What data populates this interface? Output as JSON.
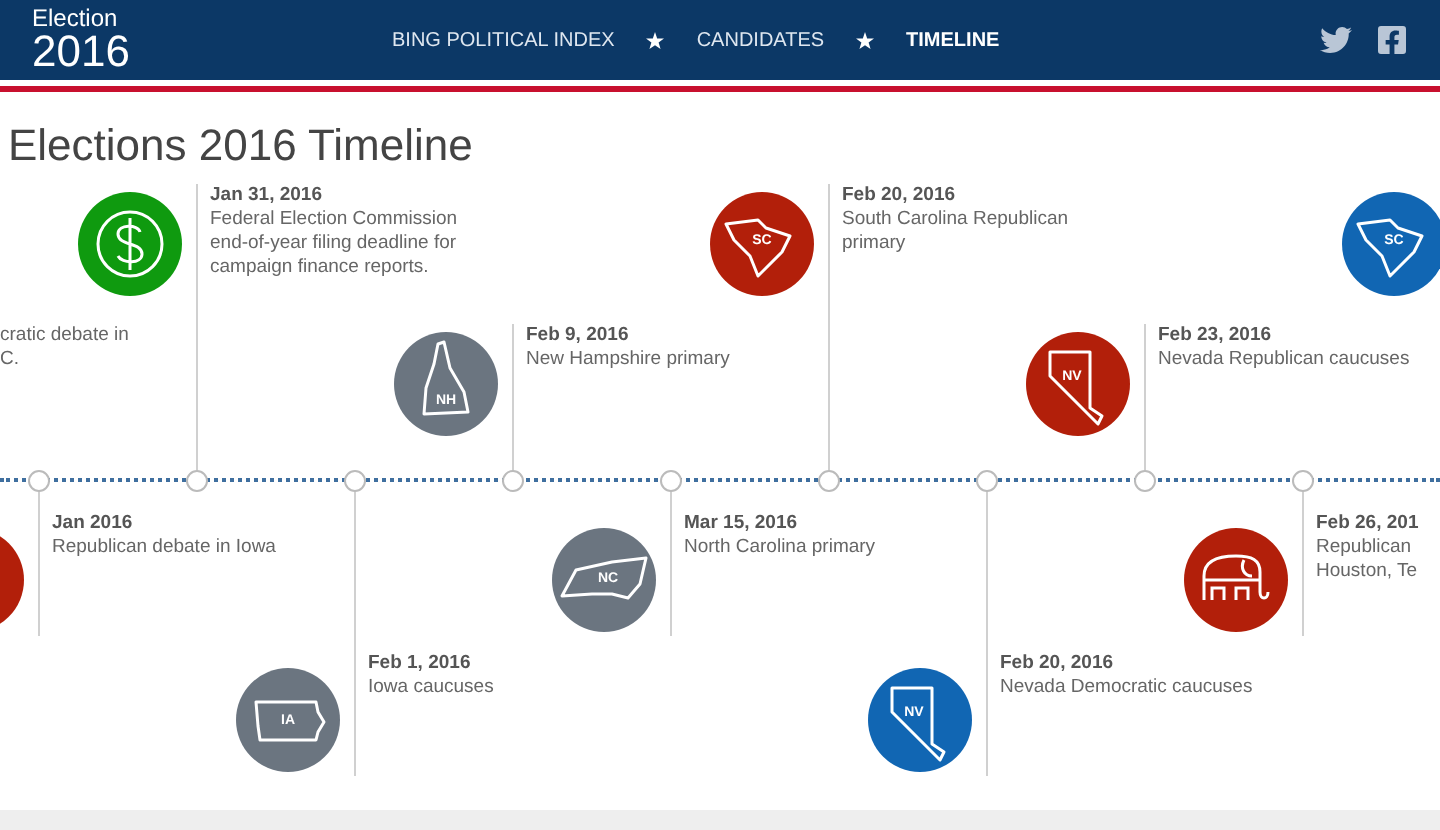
{
  "header": {
    "logo": {
      "line1": "Election",
      "line2": "2016"
    },
    "nav": [
      {
        "label": "BING POLITICAL INDEX",
        "selected": false
      },
      {
        "label": "CANDIDATES",
        "selected": false
      },
      {
        "label": "TIMELINE",
        "selected": true
      }
    ]
  },
  "page_title": "Elections 2016 Timeline",
  "timeline": {
    "events": [
      {
        "lines": [
          "cratic debate in",
          "C."
        ]
      },
      {
        "date": "Jan 2016",
        "lines": [
          "Republican debate in Iowa"
        ],
        "icon": {
          "kind": "blank",
          "color": "#b21f0a"
        }
      },
      {
        "date": "Jan 31, 2016",
        "lines": [
          "Federal Election Commission",
          "end-of-year filing deadline for",
          "campaign finance reports."
        ],
        "icon": {
          "kind": "dollar",
          "color": "#0f9a0f"
        }
      },
      {
        "date": "Feb 1, 2016",
        "lines": [
          "Iowa caucuses"
        ],
        "icon": {
          "kind": "iowa",
          "label": "IA",
          "color": "#6b7580"
        }
      },
      {
        "date": "Feb 9, 2016",
        "lines": [
          "New Hampshire primary"
        ],
        "icon": {
          "kind": "newhampshire",
          "label": "NH",
          "color": "#6b7580"
        }
      },
      {
        "date": "Mar 15, 2016",
        "lines": [
          "North Carolina primary"
        ],
        "icon": {
          "kind": "northcarolina",
          "label": "NC",
          "color": "#6b7580"
        }
      },
      {
        "date": "Feb 20, 2016",
        "lines": [
          "South Carolina Republican",
          "primary"
        ],
        "icon": {
          "kind": "southcarolina",
          "label": "SC",
          "color": "#b21f0a"
        }
      },
      {
        "date": "Feb 20, 2016",
        "lines": [
          "Nevada Democratic caucuses"
        ],
        "icon": {
          "kind": "nevada",
          "label": "NV",
          "color": "#1166b3"
        }
      },
      {
        "date": "Feb 23, 2016",
        "lines": [
          "Nevada Republican caucuses"
        ],
        "icon": {
          "kind": "nevada",
          "label": "NV",
          "color": "#b21f0a"
        }
      },
      {
        "date": "Feb 26, 201",
        "lines": [
          "Republican ",
          "Houston, Te"
        ],
        "icon": {
          "kind": "elephant",
          "color": "#b21f0a"
        }
      },
      {
        "icon": {
          "kind": "southcarolina",
          "label": "SC",
          "color": "#1166b3"
        }
      }
    ]
  }
}
